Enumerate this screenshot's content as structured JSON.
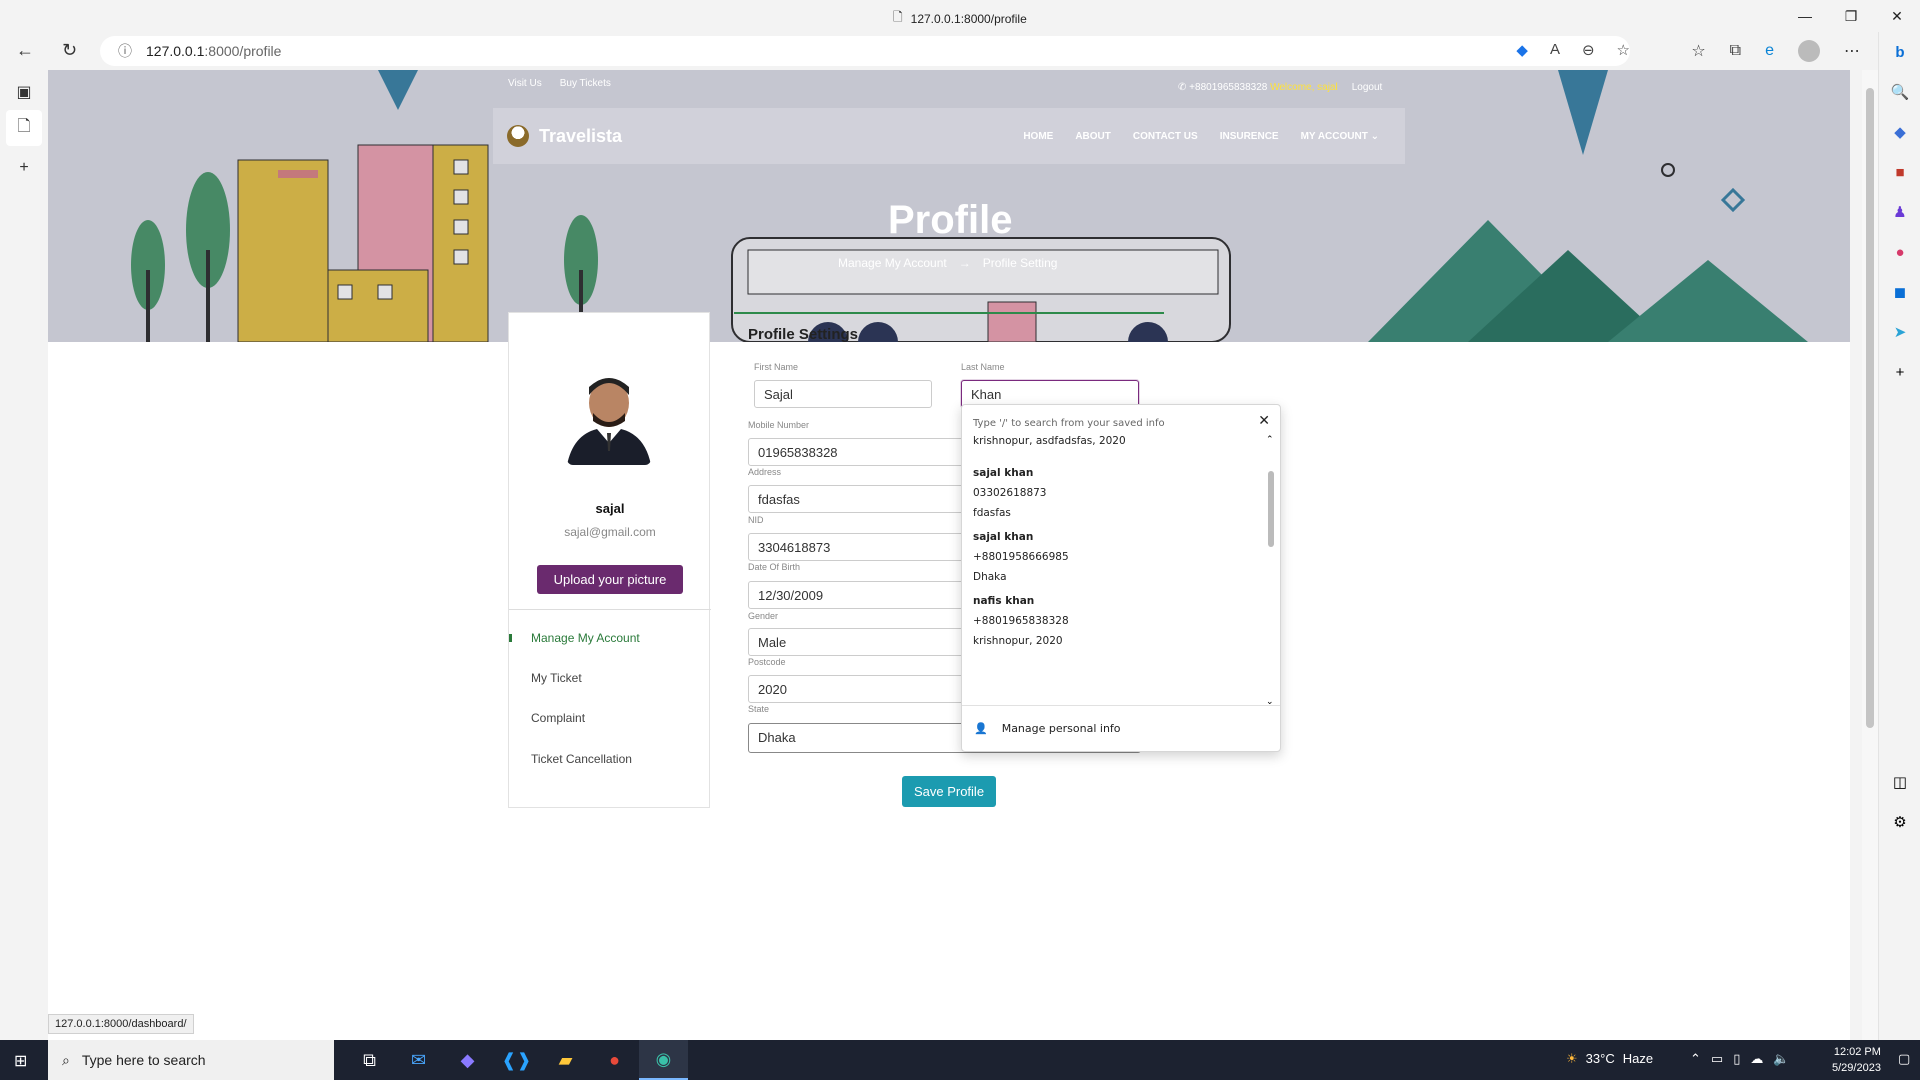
{
  "browser": {
    "tab_title": "127.0.0.1:8000/profile",
    "url_host": "127.0.0.1",
    "url_rest": ":8000/profile",
    "status_url": "127.0.0.1:8000/dashboard/"
  },
  "site": {
    "top_links": [
      "Visit Us",
      "Buy Tickets"
    ],
    "phone": "+8801965838328",
    "welcome": "Welcome, sajal",
    "logout": "Logout",
    "brand": "Travelista",
    "nav": [
      "HOME",
      "ABOUT",
      "CONTACT US",
      "INSURENCE",
      "MY ACCOUNT"
    ],
    "hero_title": "Profile",
    "breadcrumb": [
      "Manage My Account",
      "Profile Setting"
    ]
  },
  "sidebar": {
    "name": "sajal",
    "email": "sajal@gmail.com",
    "upload_label": "Upload your picture",
    "menu": [
      "Manage My Account",
      "My Ticket",
      "Complaint",
      "Ticket Cancellation"
    ]
  },
  "form": {
    "title": "Profile Settings",
    "first_name_label": "First Name",
    "first_name": "Sajal",
    "last_name_label": "Last Name",
    "last_name": "Khan",
    "mobile_label": "Mobile Number",
    "mobile": "01965838328",
    "address_label": "Address",
    "address": "fdasfas",
    "nid_label": "NID",
    "nid": "3304618873",
    "dob_label": "Date Of Birth",
    "dob": "12/30/2009",
    "gender_label": "Gender",
    "gender": "Male",
    "postcode_label": "Postcode",
    "postcode": "2020",
    "state_label": "State",
    "state": "Dhaka",
    "save_label": "Save Profile"
  },
  "autofill": {
    "hint": "Type '/' to search from your saved info",
    "first_line": "krishnopur, asdfadsfas, 2020",
    "entries": [
      {
        "name": "sajal khan",
        "phone": "03302618873",
        "address": "fdasfas"
      },
      {
        "name": "sajal khan",
        "phone": "+8801958666985",
        "address": "Dhaka"
      },
      {
        "name": "nafis khan",
        "phone": "+8801965838328",
        "address": "krishnopur, 2020"
      }
    ],
    "manage_label": "Manage personal info"
  },
  "taskbar": {
    "search_placeholder": "Type here to search",
    "temperature": "33°C",
    "condition": "Haze",
    "time": "12:02 PM",
    "date": "5/29/2023"
  }
}
